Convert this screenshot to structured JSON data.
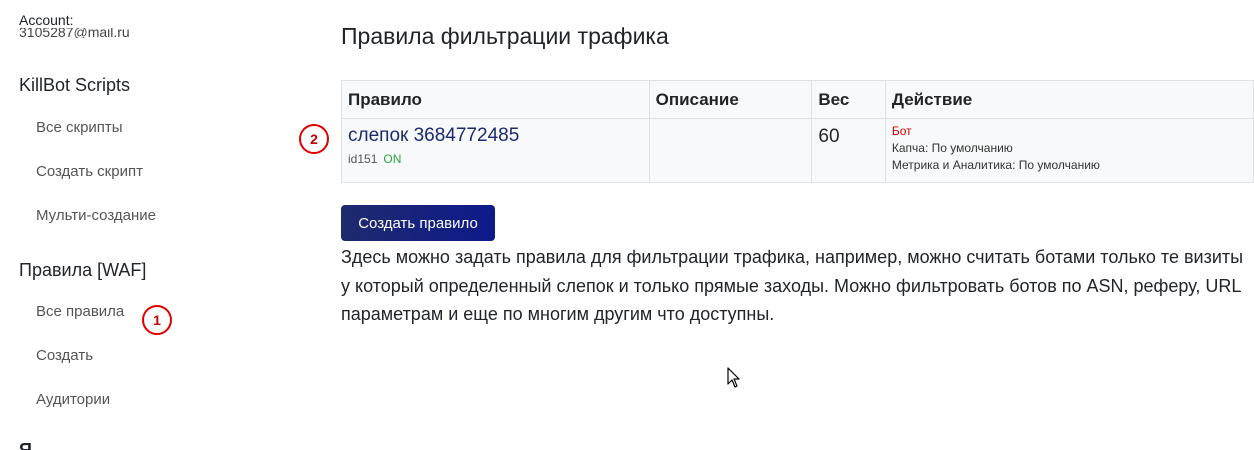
{
  "sidebar": {
    "account_label": "Account:",
    "account_email": "3105287@mail.ru",
    "section_scripts": "KillBot Scripts",
    "scripts_links": [
      "Все скрипты",
      "Создать скрипт",
      "Мульти-создание"
    ],
    "section_rules": "Правила [WAF]",
    "rules_links": [
      "Все правила",
      "Создать",
      "Аудитории"
    ],
    "next_section_partial": "Я..."
  },
  "markers": [
    "1",
    "2"
  ],
  "main": {
    "title": "Правила фильтрации трафика",
    "table": {
      "headers": [
        "Правило",
        "Описание",
        "Вес",
        "Действие"
      ],
      "rows": [
        {
          "rule_name": "слепок 3684772485",
          "rule_id": "id151",
          "rule_status": "ON",
          "description": "",
          "weight": "60",
          "action_bot": "Бот",
          "action_captcha": "Капча: По умолчанию",
          "action_metrics": "Метрика и Аналитика: По умолчанию"
        }
      ]
    },
    "create_button": "Создать правило",
    "help_text": "Здесь можно задать правила для фильтрации трафика, например, можно считать ботами только те визиты у который определенный слепок и только прямые заходы. Можно фильтровать ботов по ASN, реферу, URL параметрам и еще по многим другим что доступны."
  },
  "colors": {
    "accent_button": "#1f2a6e",
    "marker_red": "#e00000",
    "status_on": "#28a745",
    "action_bot": "#d00000",
    "rule_link": "#1a2a6c"
  },
  "icons": [
    "mouse-cursor-icon"
  ]
}
